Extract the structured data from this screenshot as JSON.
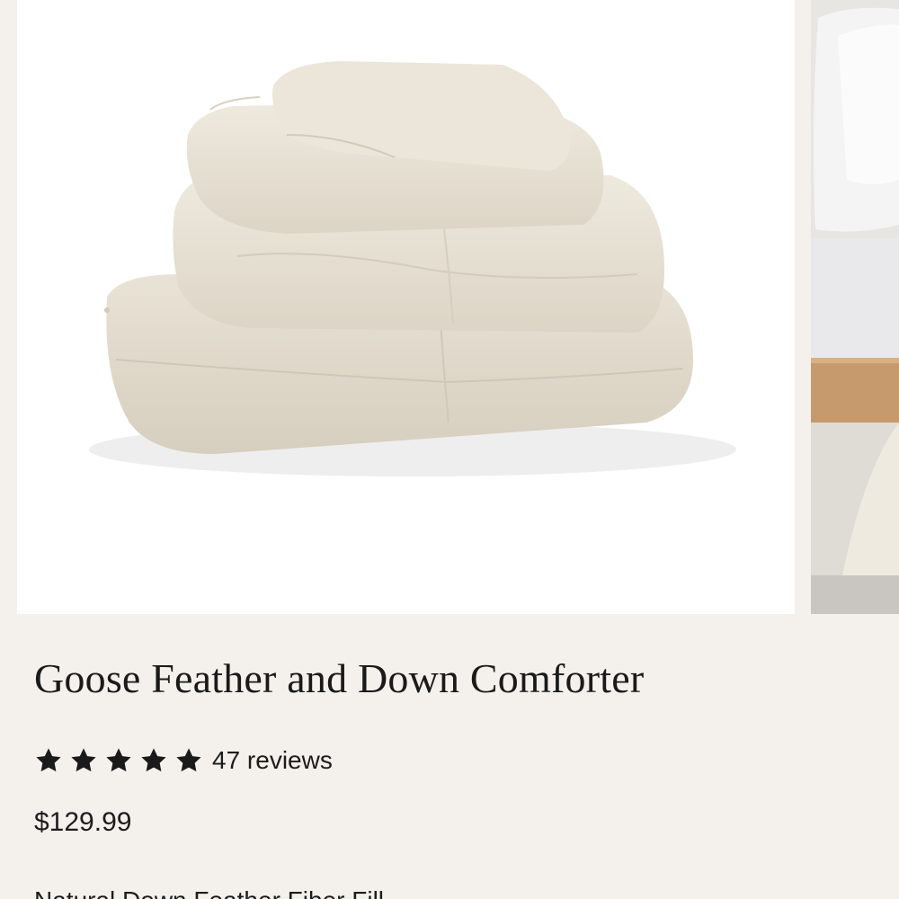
{
  "gallery": {
    "main_image_alt": "comforter-folded-stack",
    "next_image_alt": "comforter-on-bed"
  },
  "product": {
    "title": "Goose Feather and Down Comforter",
    "rating": {
      "stars": 5,
      "max_stars": 5,
      "reviews_label": "47 reviews"
    },
    "price": "$129.99",
    "feature_line_partial": "Natural Down Feather Fiber Fill"
  },
  "colors": {
    "background": "#f4f1ec",
    "star": "#1a1a1a",
    "comforter": "#ebe5d8"
  }
}
